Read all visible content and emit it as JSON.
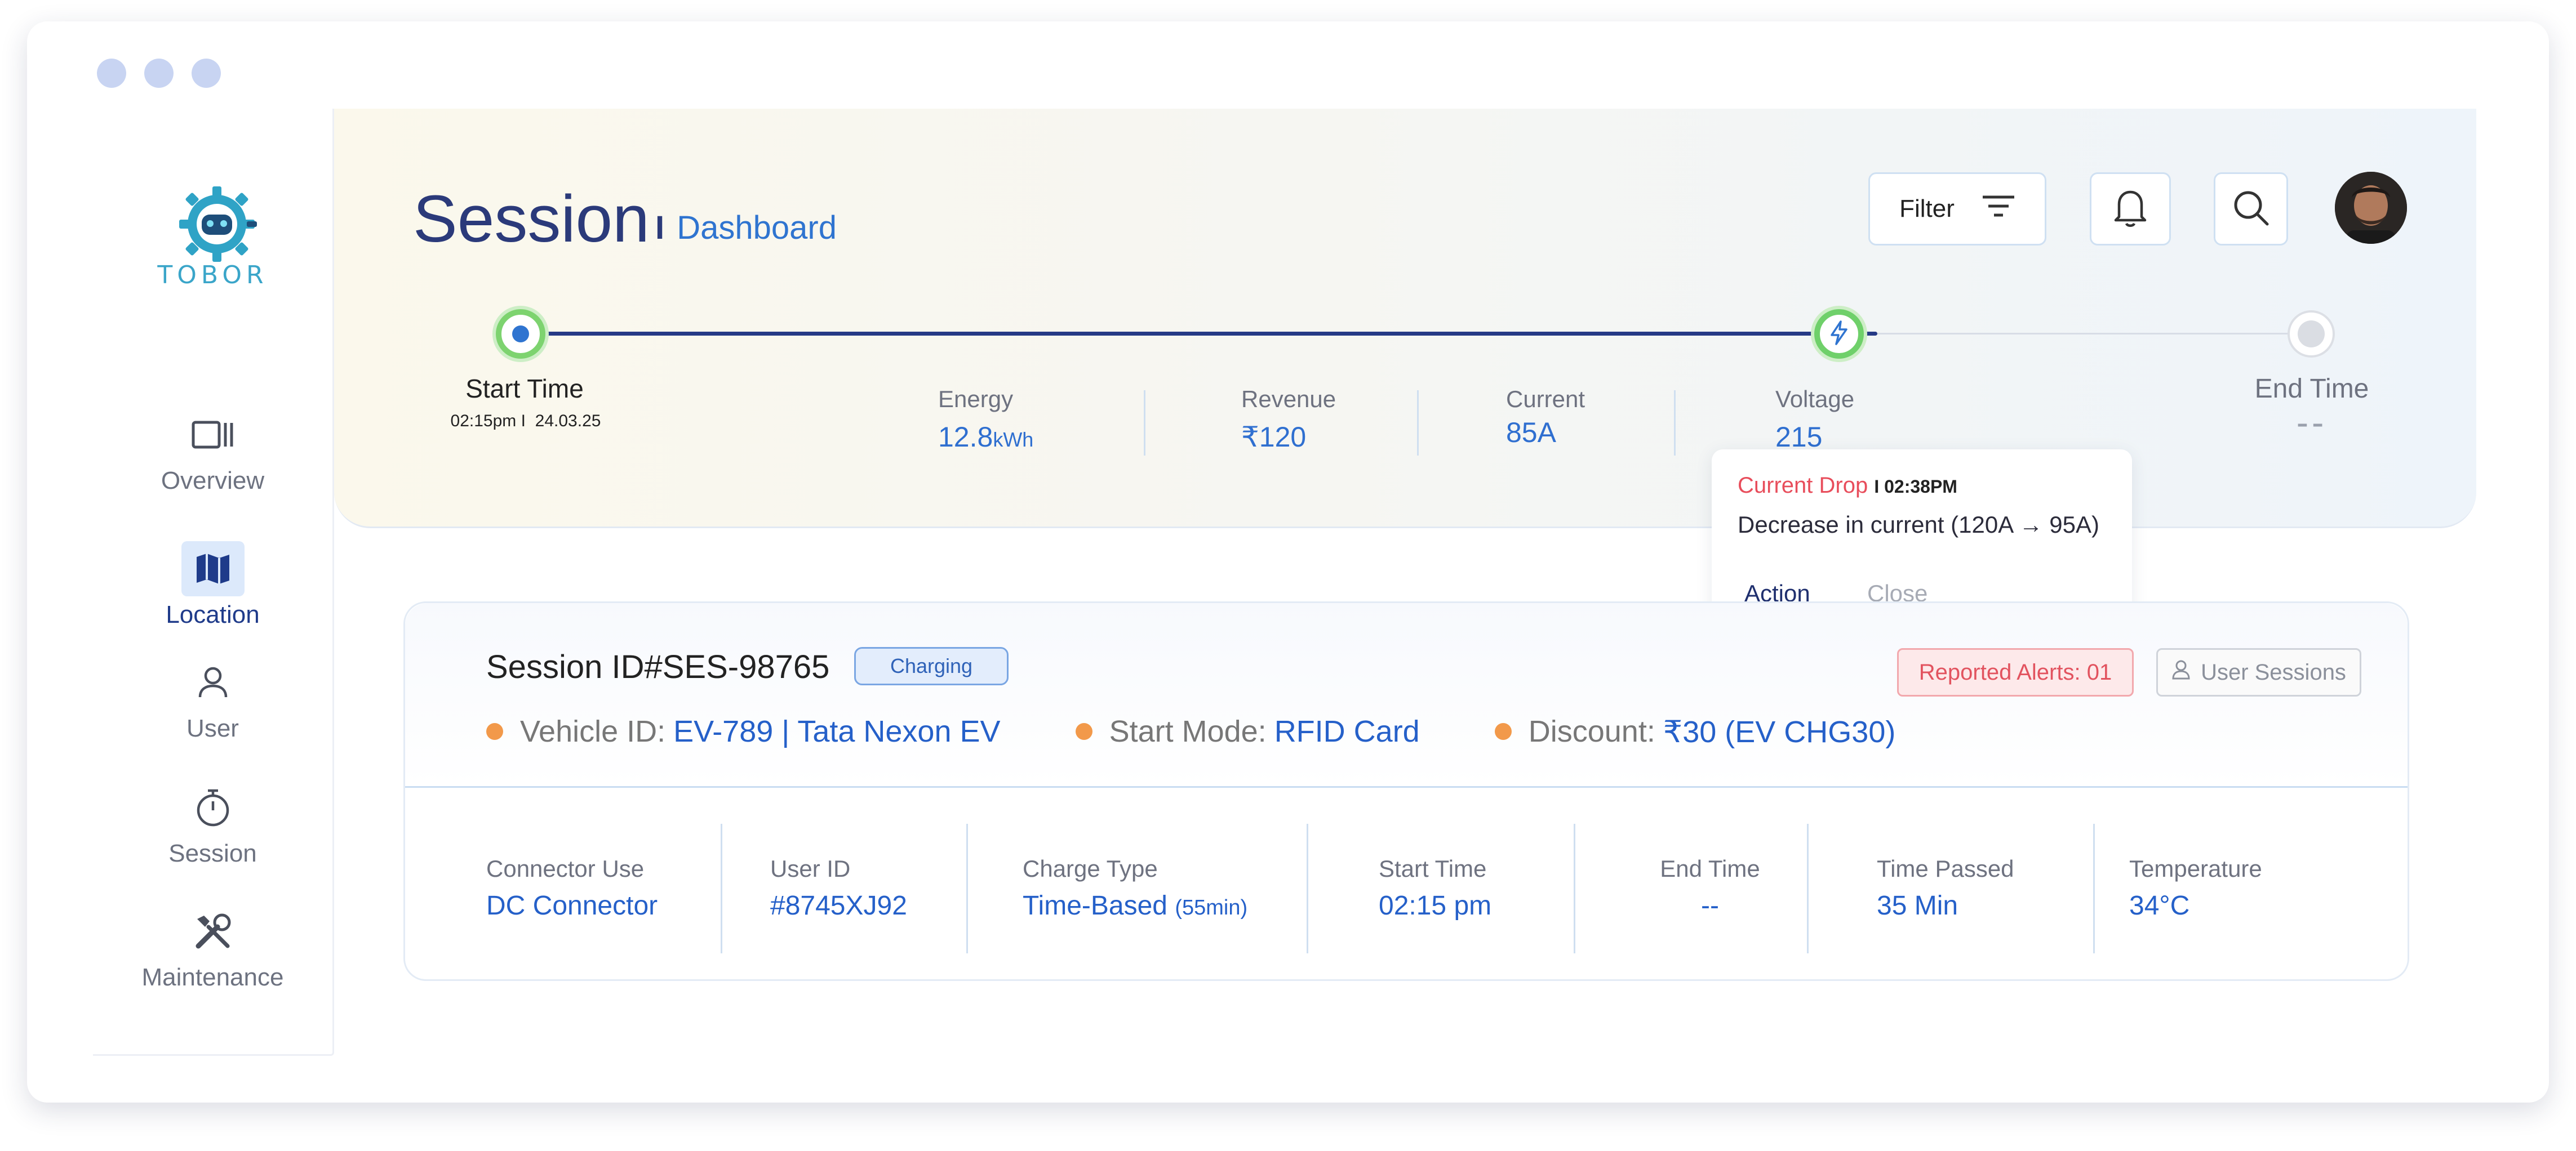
{
  "window": {
    "dots": [
      "#c8d4f2",
      "#c8d4f2",
      "#c8d4f2"
    ]
  },
  "brand": {
    "logo_icon": "robot-gear-icon",
    "name": "TOBOR",
    "accent": "#3aa5c9"
  },
  "sidebar": {
    "items": [
      {
        "label": "Overview",
        "icon": "overview-icon",
        "active": false
      },
      {
        "label": "Location",
        "icon": "map-icon",
        "active": true
      },
      {
        "label": "User",
        "icon": "user-icon",
        "active": false
      },
      {
        "label": "Session",
        "icon": "stopwatch-icon",
        "active": false
      },
      {
        "label": "Maintenance",
        "icon": "tools-icon",
        "active": false
      }
    ]
  },
  "header": {
    "title": "Session",
    "separator": "I",
    "subtitle": "Dashboard",
    "filter_label": "Filter",
    "filter_icon": "filter-lines-icon",
    "bell_icon": "bell-icon",
    "search_icon": "search-icon",
    "avatar": "user-avatar"
  },
  "timeline": {
    "start": {
      "label": "Start Time",
      "time": "02:15pm",
      "sep": "I",
      "date": "24.03.25"
    },
    "end": {
      "label": "End Time",
      "value": "--"
    },
    "progress_fraction": 0.76,
    "metrics": [
      {
        "label": "Energy",
        "value": "12.8",
        "unit": "kWh"
      },
      {
        "label": "Revenue",
        "value": "₹120",
        "unit": ""
      },
      {
        "label": "Current",
        "value": "85A",
        "unit": ""
      },
      {
        "label": "Voltage",
        "value": "215",
        "unit": ""
      }
    ],
    "mid_node_icon": "lightning-icon"
  },
  "alert_popup": {
    "title": "Current Drop",
    "sep": "I",
    "time": "02:38PM",
    "message": "Decrease in current (120A → 95A)",
    "action_label": "Action",
    "close_label": "Close"
  },
  "session": {
    "id": "Session ID#SES-98765",
    "status": "Charging",
    "alerts_label": "Reported Alerts: 01",
    "user_sessions_label": "User Sessions",
    "info": [
      {
        "label": "Vehicle ID:",
        "value": "EV-789 | Tata Nexon EV"
      },
      {
        "label": "Start Mode:",
        "value": "RFID Card"
      },
      {
        "label": "Discount:",
        "value": "₹30 (EV CHG30)"
      }
    ],
    "details": [
      {
        "label": "Connector Use",
        "value": "DC Connector",
        "extra": ""
      },
      {
        "label": "User ID",
        "value": "#8745XJ92",
        "extra": ""
      },
      {
        "label": "Charge Type",
        "value": "Time-Based",
        "extra": "(55min)"
      },
      {
        "label": "Start Time",
        "value": "02:15 pm",
        "extra": ""
      },
      {
        "label": "End Time",
        "value": "--",
        "extra": ""
      },
      {
        "label": "Time Passed",
        "value": "35 Min",
        "extra": ""
      },
      {
        "label": "Temperature",
        "value": "34°C",
        "extra": ""
      }
    ]
  }
}
